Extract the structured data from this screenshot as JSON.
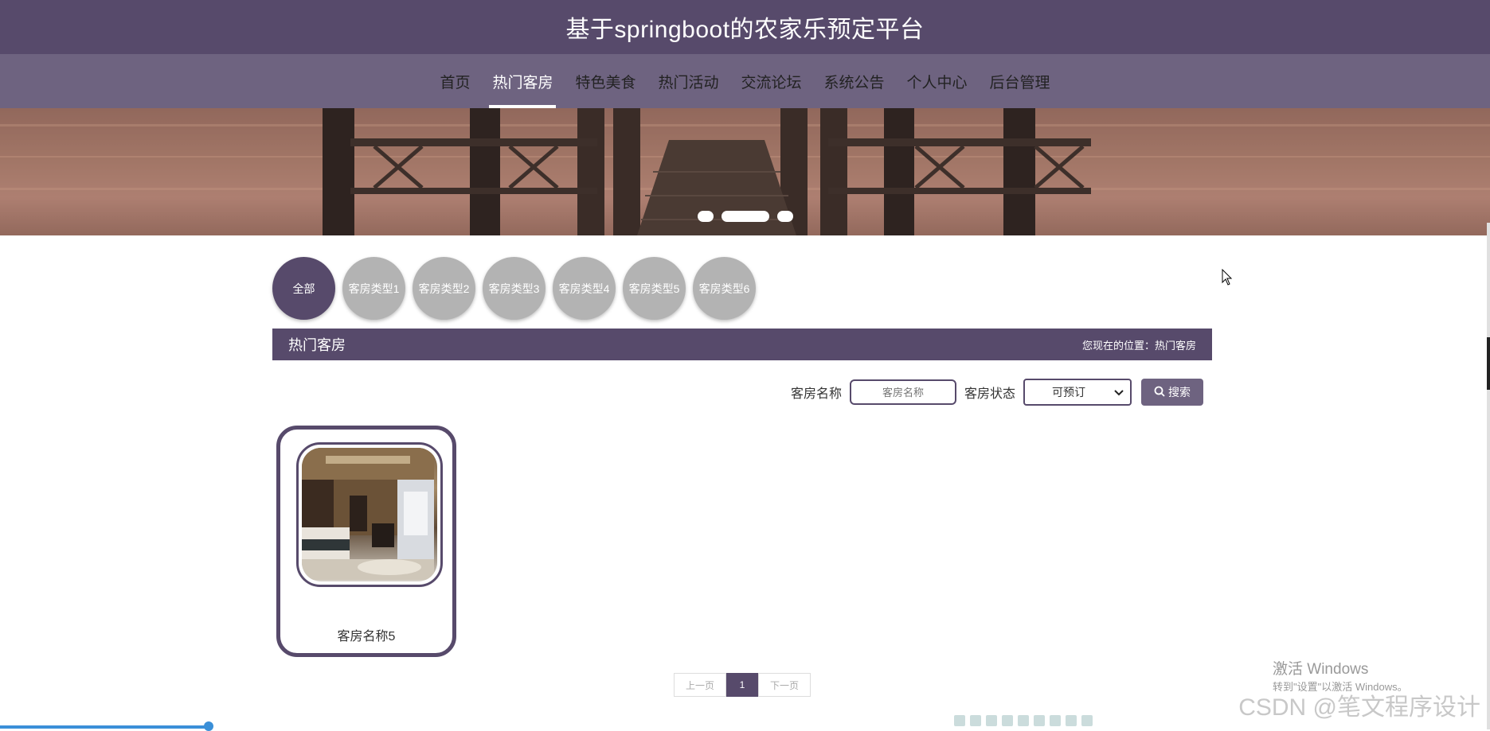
{
  "app": {
    "title": "基于springboot的农家乐预定平台"
  },
  "nav": {
    "items": [
      {
        "label": "首页"
      },
      {
        "label": "热门客房",
        "active": true
      },
      {
        "label": "特色美食"
      },
      {
        "label": "热门活动"
      },
      {
        "label": "交流论坛"
      },
      {
        "label": "系统公告"
      },
      {
        "label": "个人中心"
      },
      {
        "label": "后台管理"
      }
    ]
  },
  "banner": {
    "active_slide": 2,
    "slide_count": 3
  },
  "categories": [
    {
      "label": "全部",
      "active": true
    },
    {
      "label": "客房类型1"
    },
    {
      "label": "客房类型2"
    },
    {
      "label": "客房类型3"
    },
    {
      "label": "客房类型4"
    },
    {
      "label": "客房类型5"
    },
    {
      "label": "客房类型6"
    }
  ],
  "section": {
    "title": "热门客房",
    "breadcrumb": "您现在的位置：热门客房"
  },
  "search": {
    "name_label": "客房名称",
    "name_placeholder": "客房名称",
    "status_label": "客房状态",
    "status_value": "可预订",
    "button_label": "搜索"
  },
  "rooms": [
    {
      "name": "客房名称5"
    }
  ],
  "pagination": {
    "prev_label": "上一页",
    "current_page": "1",
    "next_label": "下一页"
  },
  "overlay": {
    "windows_title": "激活 Windows",
    "windows_sub": "转到\"设置\"以激活 Windows。",
    "csdn": "CSDN @笔文程序设计"
  },
  "colors": {
    "primary": "#574a6b",
    "nav_bg": "#6e6380",
    "category_inactive": "#b3b3b3"
  }
}
